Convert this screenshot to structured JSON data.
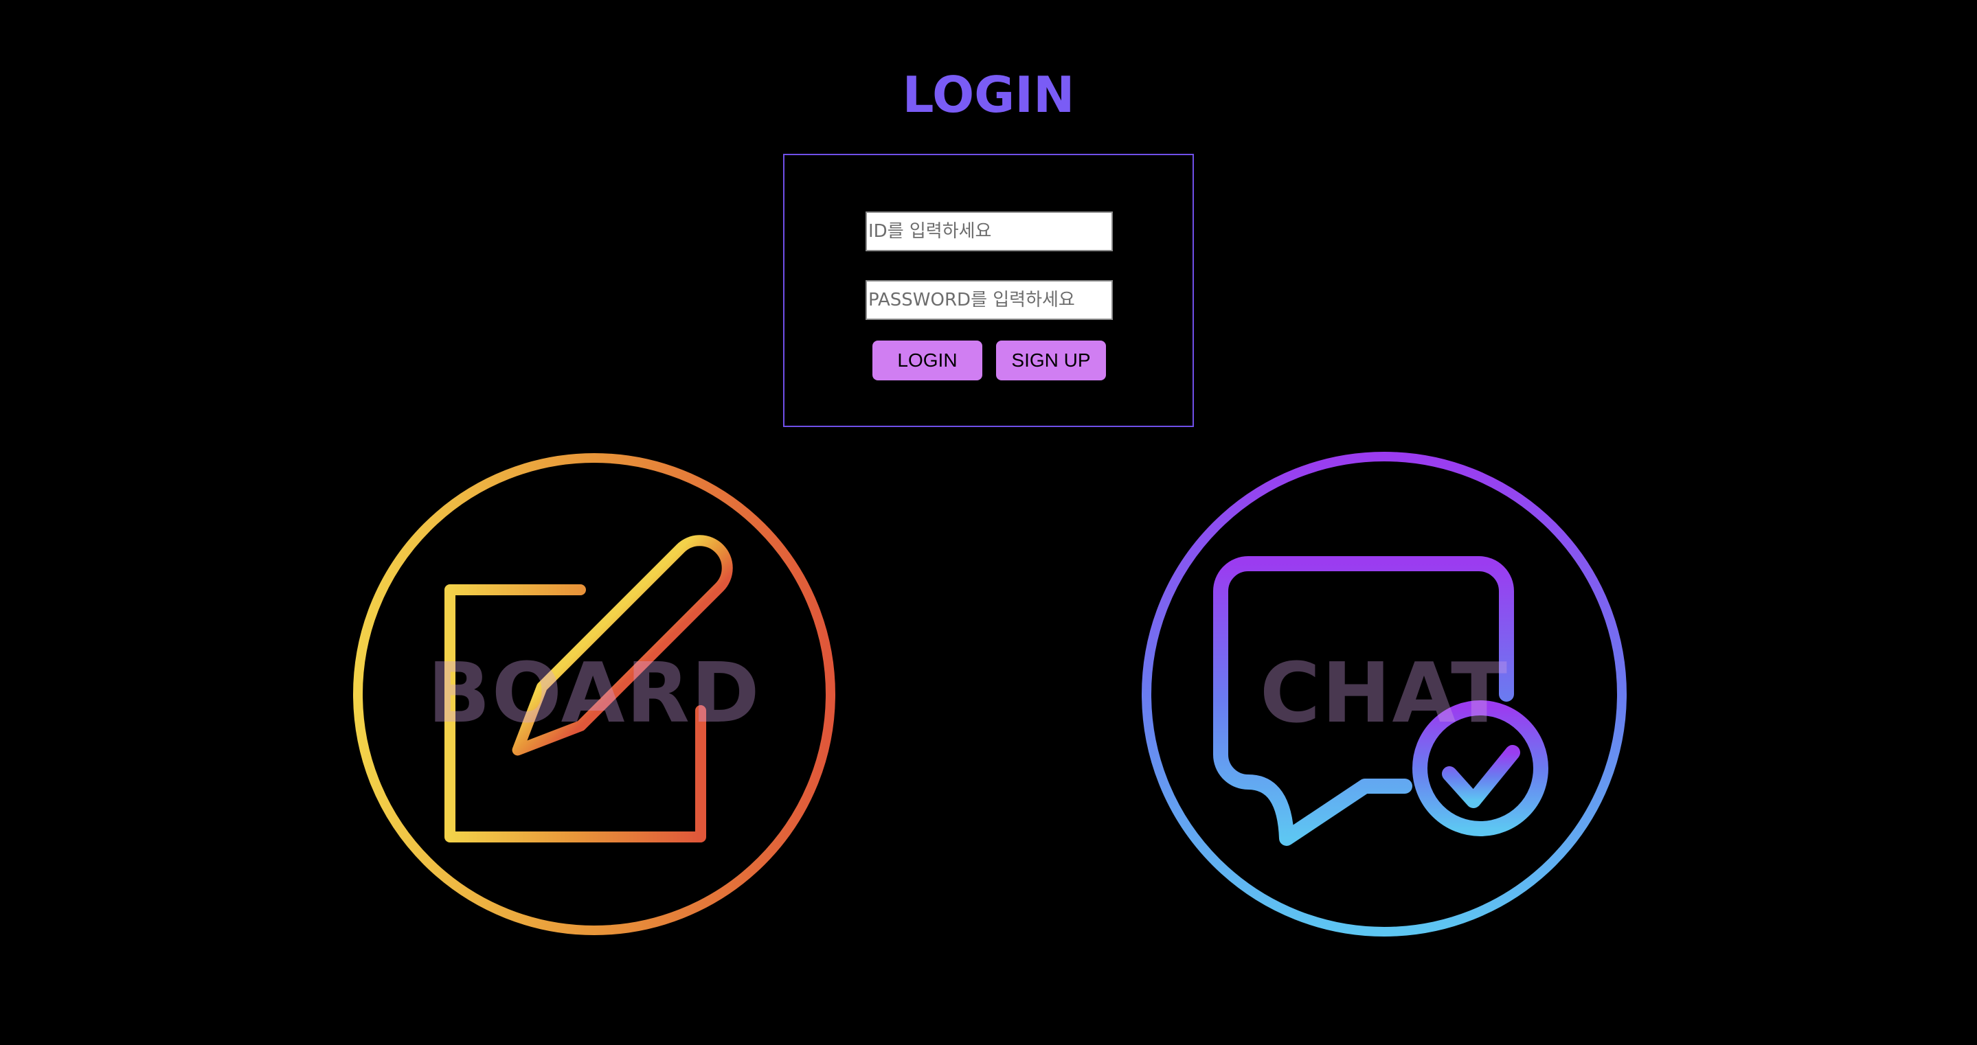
{
  "header": {
    "title": "LOGIN"
  },
  "login_form": {
    "id_placeholder": "ID를 입력하세요",
    "password_placeholder": "PASSWORD를 입력하세요",
    "login_label": "LOGIN",
    "signup_label": "SIGN UP"
  },
  "tiles": {
    "board": {
      "label": "BOARD",
      "icon": "edit-note-icon"
    },
    "chat": {
      "label": "CHAT",
      "icon": "chat-check-icon"
    }
  },
  "colors": {
    "background": "#000000",
    "title": "#7a5cf5",
    "box_border": "#6f4fe8",
    "button": "#d07ef2",
    "board_gradient_start": "#f3d24a",
    "board_gradient_end": "#e0573a",
    "chat_gradient_start": "#9b3cf0",
    "chat_gradient_end": "#5ec6f2"
  }
}
